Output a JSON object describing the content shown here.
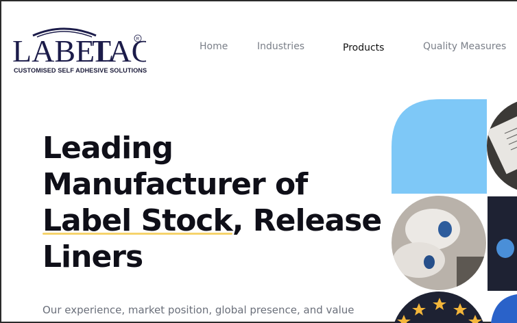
{
  "brand": {
    "name_part1": "LABEL",
    "name_part2": "TAC",
    "registered": "R",
    "tagline": "CUSTOMISED SELF ADHESIVE SOLUTIONS",
    "color": "#1c1c4a"
  },
  "nav": {
    "items": [
      {
        "label": "Home",
        "active": false
      },
      {
        "label": "Industries",
        "active": false
      },
      {
        "label": "Products",
        "active": true
      },
      {
        "label": "Quality Measures",
        "active": false
      }
    ]
  },
  "hero": {
    "line1": "Leading",
    "line2": "Manufacturer of",
    "line3_highlight": "Label Stock",
    "line3_rest": ", Release",
    "line4": "Liners",
    "subtitle": "Our experience, market position, global presence, and value",
    "highlight_color": "#f6d36b"
  },
  "colors": {
    "accent_blue": "#7ec8f7",
    "dark_navy": "#1e2233",
    "star_yellow": "#f4b63a"
  }
}
